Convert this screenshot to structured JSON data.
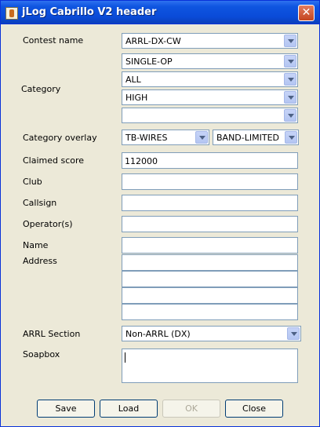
{
  "window": {
    "title": "jLog Cabrillo V2 header"
  },
  "icons": {
    "app": "jlog-app-icon",
    "close": "close-icon",
    "dropdown": "chevron-down-icon",
    "close_glyph": "✕"
  },
  "form": {
    "contest_name": {
      "label": "Contest name",
      "value": "ARRL-DX-CW"
    },
    "category": {
      "label": "Category",
      "values": [
        "SINGLE-OP",
        "ALL",
        "HIGH",
        ""
      ]
    },
    "category_overlay": {
      "label": "Category overlay",
      "values": [
        "TB-WIRES",
        "BAND-LIMITED"
      ]
    },
    "claimed_score": {
      "label": "Claimed score",
      "value": "112000"
    },
    "club": {
      "label": "Club",
      "value": ""
    },
    "callsign": {
      "label": "Callsign",
      "value": ""
    },
    "operators": {
      "label": "Operator(s)",
      "value": ""
    },
    "name": {
      "label": "Name",
      "value": ""
    },
    "address": {
      "label": "Address",
      "lines": [
        "",
        "",
        "",
        ""
      ]
    },
    "arrl_section": {
      "label": "ARRL Section",
      "value": "Non-ARRL (DX)"
    },
    "soapbox": {
      "label": "Soapbox",
      "value": ""
    }
  },
  "buttons": {
    "save": "Save",
    "load": "Load",
    "ok": "OK",
    "close": "Close"
  }
}
